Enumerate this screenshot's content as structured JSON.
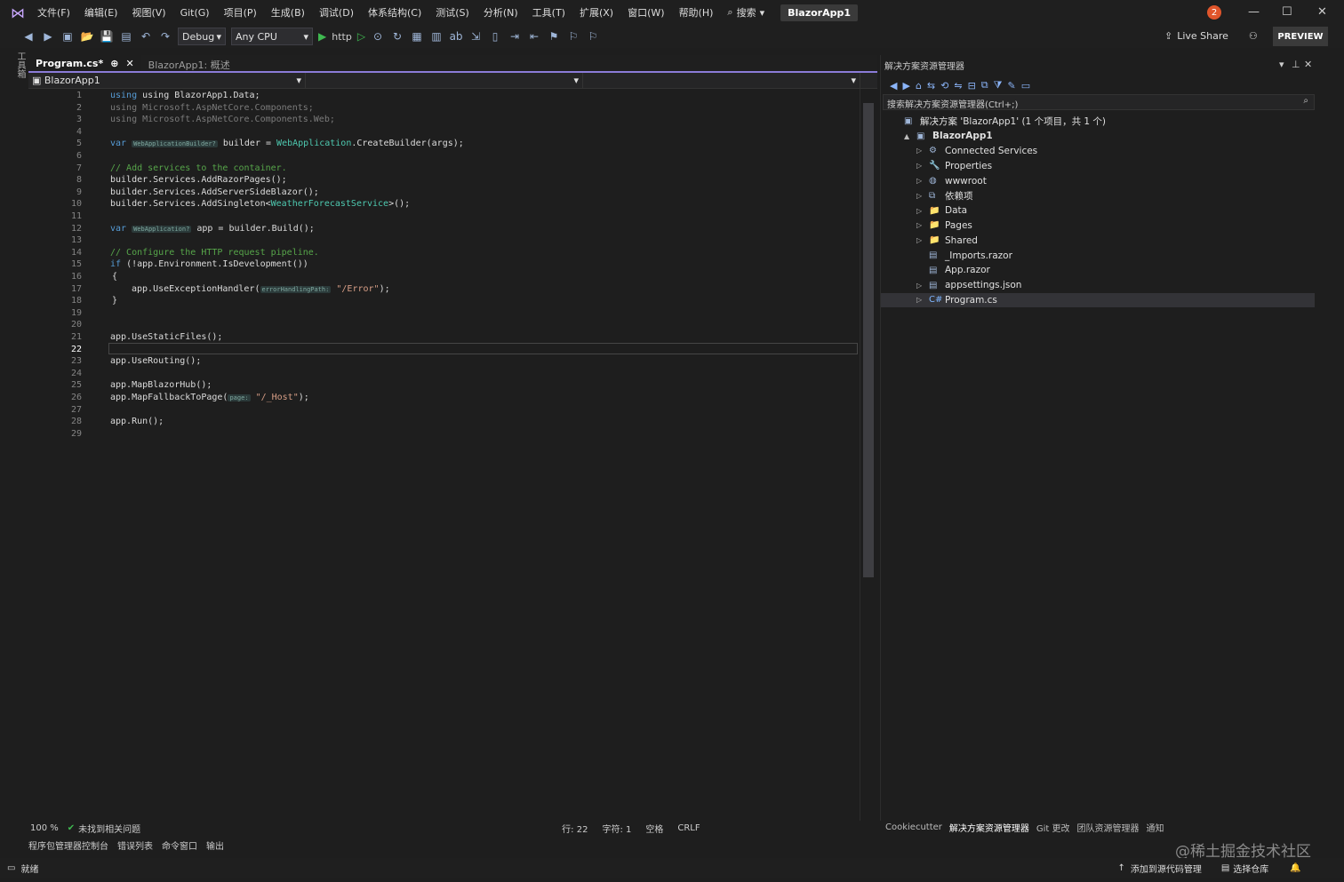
{
  "menubar": {
    "items": [
      "文件(F)",
      "编辑(E)",
      "视图(V)",
      "Git(G)",
      "项目(P)",
      "生成(B)",
      "调试(D)",
      "体系结构(C)",
      "测试(S)",
      "分析(N)",
      "工具(T)",
      "扩展(X)",
      "窗口(W)",
      "帮助(H)"
    ],
    "search_label": "搜索",
    "solution_title": "BlazorApp1",
    "notifications": "2"
  },
  "toolbar": {
    "config": "Debug",
    "platform": "Any CPU",
    "run_target": "http",
    "live_share": "Live Share",
    "preview": "PREVIEW"
  },
  "left_tool_window": "工具箱",
  "editor": {
    "tabs": [
      {
        "label": "Program.cs*",
        "active": true
      },
      {
        "label": "BlazorApp1: 概述",
        "active": false
      }
    ],
    "nav_project": "BlazorApp1",
    "current_line": 22,
    "hints": {
      "builder_type": "WebApplicationBuilder?",
      "app_type": "WebApplication?",
      "error_param": "errorHandlingPath:",
      "page_param": "page:"
    },
    "code": {
      "l1": "using BlazorApp1.Data;",
      "l2": "using Microsoft.AspNetCore.Components;",
      "l3": "using Microsoft.AspNetCore.Components.Web;",
      "l5a": "var ",
      "l5b": " builder = ",
      "l5c": "WebApplication",
      "l5d": ".CreateBuilder(args);",
      "l7": "// Add services to the container.",
      "l8": "builder.Services.AddRazorPages();",
      "l9": "builder.Services.AddServerSideBlazor();",
      "l10a": "builder.Services.AddSingleton<",
      "l10b": "WeatherForecastService",
      "l10c": ">();",
      "l12a": "var ",
      "l12b": " app = builder.Build();",
      "l14": "// Configure the HTTP request pipeline.",
      "l15a": "if",
      "l15b": " (!app.Environment.IsDevelopment())",
      "l16": "{",
      "l17a": "app.UseExceptionHandler(",
      "l17b": "\"/Error\"",
      "l17c": ");",
      "l18": "}",
      "l21": "app.UseStaticFiles();",
      "l23": "app.UseRouting();",
      "l25": "app.MapBlazorHub();",
      "l26a": "app.MapFallbackToPage(",
      "l26b": "\"/_Host\"",
      "l26c": ");",
      "l28": "app.Run();"
    },
    "line_numbers": [
      "1",
      "2",
      "3",
      "4",
      "5",
      "6",
      "7",
      "8",
      "9",
      "10",
      "11",
      "12",
      "13",
      "14",
      "15",
      "16",
      "17",
      "18",
      "19",
      "20",
      "21",
      "22",
      "23",
      "24",
      "25",
      "26",
      "27",
      "28",
      "29"
    ]
  },
  "editor_status": {
    "zoom": "100 %",
    "issues": "未找到相关问题",
    "line": "行: 22",
    "char": "字符: 1",
    "spacing": "空格",
    "eol": "CRLF"
  },
  "bottom_tabs": [
    "程序包管理器控制台",
    "错误列表",
    "命令窗口",
    "输出"
  ],
  "statusbar": {
    "ready": "就绪",
    "add_source": "添加到源代码管理",
    "select_repo": "选择仓库"
  },
  "solution_explorer": {
    "title": "解决方案资源管理器",
    "search_placeholder": "搜索解决方案资源管理器(Ctrl+;)",
    "tree": [
      {
        "label": "解决方案 'BlazorApp1' (1 个项目，共 1 个)",
        "indent": 0,
        "arrow": "",
        "icon": "solution-icon"
      },
      {
        "label": "BlazorApp1",
        "indent": 1,
        "arrow": "▲",
        "icon": "project-icon",
        "bold": true
      },
      {
        "label": "Connected Services",
        "indent": 2,
        "arrow": "▷",
        "icon": "connected-services-icon"
      },
      {
        "label": "Properties",
        "indent": 2,
        "arrow": "▷",
        "icon": "properties-icon"
      },
      {
        "label": "wwwroot",
        "indent": 2,
        "arrow": "▷",
        "icon": "globe-icon"
      },
      {
        "label": "依赖项",
        "indent": 2,
        "arrow": "▷",
        "icon": "dependencies-icon"
      },
      {
        "label": "Data",
        "indent": 2,
        "arrow": "▷",
        "icon": "folder-icon"
      },
      {
        "label": "Pages",
        "indent": 2,
        "arrow": "▷",
        "icon": "folder-icon"
      },
      {
        "label": "Shared",
        "indent": 2,
        "arrow": "▷",
        "icon": "folder-icon"
      },
      {
        "label": "_Imports.razor",
        "indent": 2,
        "arrow": "",
        "icon": "file-icon"
      },
      {
        "label": "App.razor",
        "indent": 2,
        "arrow": "",
        "icon": "file-icon"
      },
      {
        "label": "appsettings.json",
        "indent": 2,
        "arrow": "▷",
        "icon": "json-file-icon"
      },
      {
        "label": "Program.cs",
        "indent": 2,
        "arrow": "▷",
        "icon": "csharp-file-icon",
        "selected": true
      }
    ],
    "tabs": [
      "Cookiecutter",
      "解决方案资源管理器",
      "Git 更改",
      "团队资源管理器",
      "通知"
    ]
  },
  "watermark": "@稀土掘金技术社区"
}
